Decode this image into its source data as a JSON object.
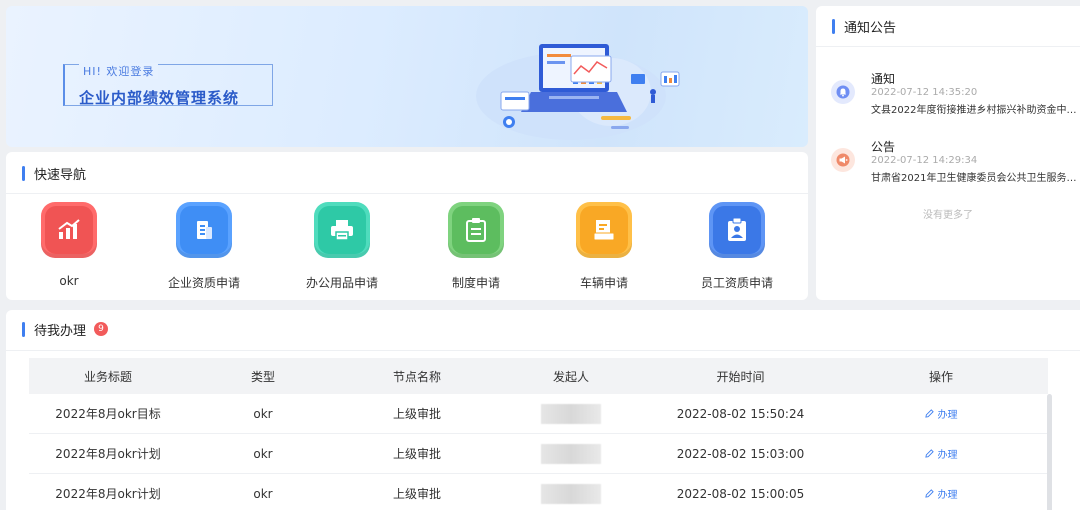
{
  "banner": {
    "greeting": "HI! 欢迎登录",
    "title": "企业内部绩效管理系统"
  },
  "quick_nav": {
    "title": "快速导航",
    "items": [
      {
        "label": "okr",
        "icon": "chart-icon",
        "color": "#f05454"
      },
      {
        "label": "企业资质申请",
        "icon": "building-icon",
        "color": "#3f8ef5"
      },
      {
        "label": "办公用品申请",
        "icon": "printer-icon",
        "color": "#2ec9a6"
      },
      {
        "label": "制度申请",
        "icon": "clipboard-icon",
        "color": "#5dbd5f"
      },
      {
        "label": "车辆申请",
        "icon": "document-icon",
        "color": "#f9a825"
      },
      {
        "label": "员工资质申请",
        "icon": "badge-icon",
        "color": "#3b78e7"
      }
    ]
  },
  "notices": {
    "title": "通知公告",
    "items": [
      {
        "type": "通知",
        "time": "2022-07-12 14:35:20",
        "text": "文县2022年度衔接推进乡村振兴补助资金中期…",
        "icon": "bell-icon",
        "color": "#6f8ef3"
      },
      {
        "type": "公告",
        "time": "2022-07-12 14:29:34",
        "text": "甘肃省2021年卫生健康委员会公共卫生服务补…",
        "icon": "megaphone-icon",
        "color": "#ef8a6a"
      }
    ],
    "no_more": "没有更多了"
  },
  "todo": {
    "title": "待我办理",
    "count": "9",
    "columns": [
      "业务标题",
      "类型",
      "节点名称",
      "发起人",
      "开始时间",
      "操作"
    ],
    "rows": [
      {
        "title": "2022年8月okr目标",
        "type": "okr",
        "node": "上级审批",
        "start": "2022-08-02 15:50:24",
        "action": "办理"
      },
      {
        "title": "2022年8月okr计划",
        "type": "okr",
        "node": "上级审批",
        "start": "2022-08-02 15:03:00",
        "action": "办理"
      },
      {
        "title": "2022年8月okr计划",
        "type": "okr",
        "node": "上级审批",
        "start": "2022-08-02 15:00:05",
        "action": "办理"
      }
    ]
  },
  "colors": {
    "accent": "#3f7ff0",
    "badge": "#f25b5b"
  }
}
